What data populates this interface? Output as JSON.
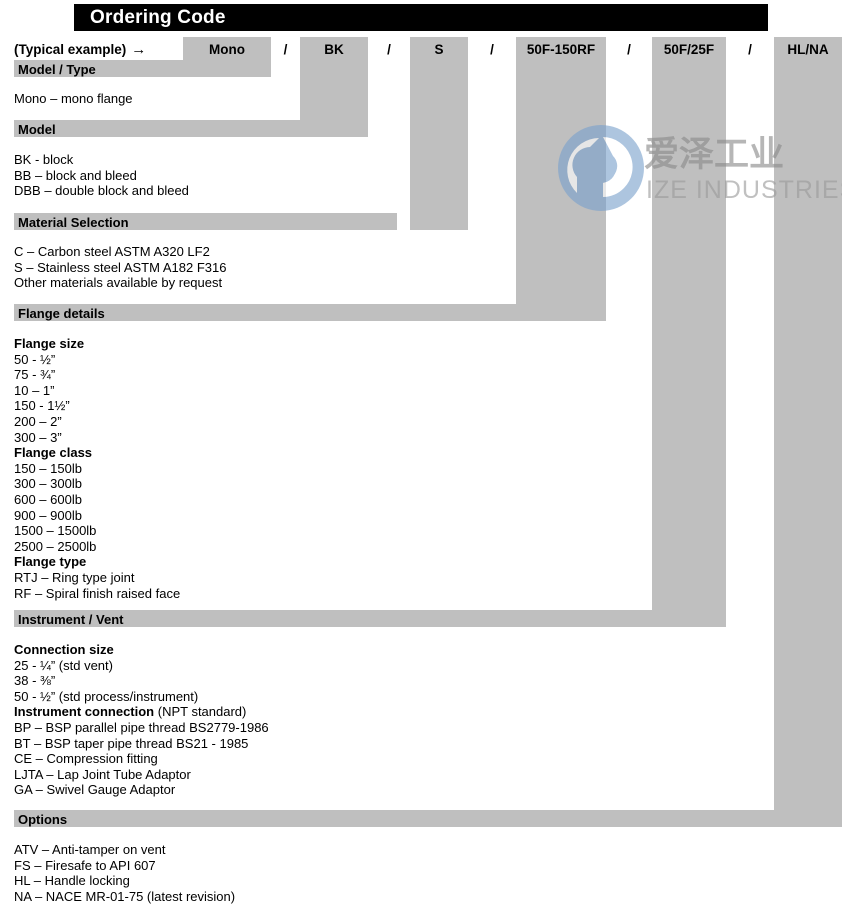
{
  "header": {
    "title": "Ordering Code"
  },
  "example_row": {
    "label": "(Typical example)",
    "arrow": "→",
    "separator": "/",
    "codes": [
      "Mono",
      "BK",
      "S",
      "50F-150RF",
      "50F/25F",
      "HL/NA"
    ]
  },
  "watermark": {
    "chinese": "爱泽工业",
    "english": "IZE INDUSTRIES",
    "logo_color": "#7ba2cc",
    "text_color": "#8a8a8a"
  },
  "colors": {
    "bar_gray": "#bfbfbf",
    "header_black": "#000000",
    "text": "#000000"
  },
  "sections": [
    {
      "id": "model-type",
      "heading": "Model / Type",
      "lines": [
        {
          "text": "Mono – mono flange",
          "bold": false
        }
      ]
    },
    {
      "id": "model",
      "heading": "Model",
      "lines": [
        {
          "text": "BK - block",
          "bold": false
        },
        {
          "text": "BB – block and bleed",
          "bold": false
        },
        {
          "text": "DBB – double block and bleed",
          "bold": false
        }
      ]
    },
    {
      "id": "material-selection",
      "heading": "Material Selection",
      "lines": [
        {
          "text": "C – Carbon steel ASTM A320 LF2",
          "bold": false
        },
        {
          "text": "S – Stainless steel ASTM A182 F316",
          "bold": false
        },
        {
          "text": "Other materials available by request",
          "bold": false
        }
      ]
    },
    {
      "id": "flange-details",
      "heading": "Flange details",
      "lines": [
        {
          "text": "Flange size",
          "bold": true
        },
        {
          "text": "50 - ½”",
          "bold": false
        },
        {
          "text": "75 - ¾”",
          "bold": false
        },
        {
          "text": "10 – 1”",
          "bold": false
        },
        {
          "text": "150 - 1½”",
          "bold": false
        },
        {
          "text": "200 – 2”",
          "bold": false
        },
        {
          "text": "300 – 3”",
          "bold": false
        },
        {
          "text": "Flange class",
          "bold": true
        },
        {
          "text": "150 – 150lb",
          "bold": false
        },
        {
          "text": "300 – 300lb",
          "bold": false
        },
        {
          "text": "600 – 600lb",
          "bold": false
        },
        {
          "text": "900 – 900lb",
          "bold": false
        },
        {
          "text": "1500 – 1500lb",
          "bold": false
        },
        {
          "text": "2500 – 2500lb",
          "bold": false
        },
        {
          "text": "Flange type",
          "bold": true
        },
        {
          "text": "RTJ – Ring type joint",
          "bold": false
        },
        {
          "text": "RF – Spiral finish raised face",
          "bold": false
        }
      ]
    },
    {
      "id": "instrument-vent",
      "heading": "Instrument / Vent",
      "lines": [
        {
          "text": "Connection size",
          "bold": true
        },
        {
          "text": "25 - ¼” (std vent)",
          "bold": false
        },
        {
          "text": "38 - ⅜”",
          "bold": false
        },
        {
          "text": "50 - ½” (std process/instrument)",
          "bold": false
        },
        {
          "text": "Instrument connection",
          "bold": true,
          "suffix": " (NPT standard)"
        },
        {
          "text": "BP – BSP parallel pipe thread BS2779-1986",
          "bold": false
        },
        {
          "text": "BT – BSP taper pipe thread BS21 - 1985",
          "bold": false
        },
        {
          "text": "CE – Compression fitting",
          "bold": false
        },
        {
          "text": "LJTA – Lap Joint Tube Adaptor",
          "bold": false
        },
        {
          "text": "GA – Swivel Gauge Adaptor",
          "bold": false
        }
      ]
    },
    {
      "id": "options",
      "heading": "Options",
      "lines": [
        {
          "text": "ATV – Anti-tamper on vent",
          "bold": false
        },
        {
          "text": "FS – Firesafe to API 607",
          "bold": false
        },
        {
          "text": "HL – Handle locking",
          "bold": false
        },
        {
          "text": "NA – NACE MR-01-75 (latest revision)",
          "bold": false
        }
      ]
    }
  ]
}
